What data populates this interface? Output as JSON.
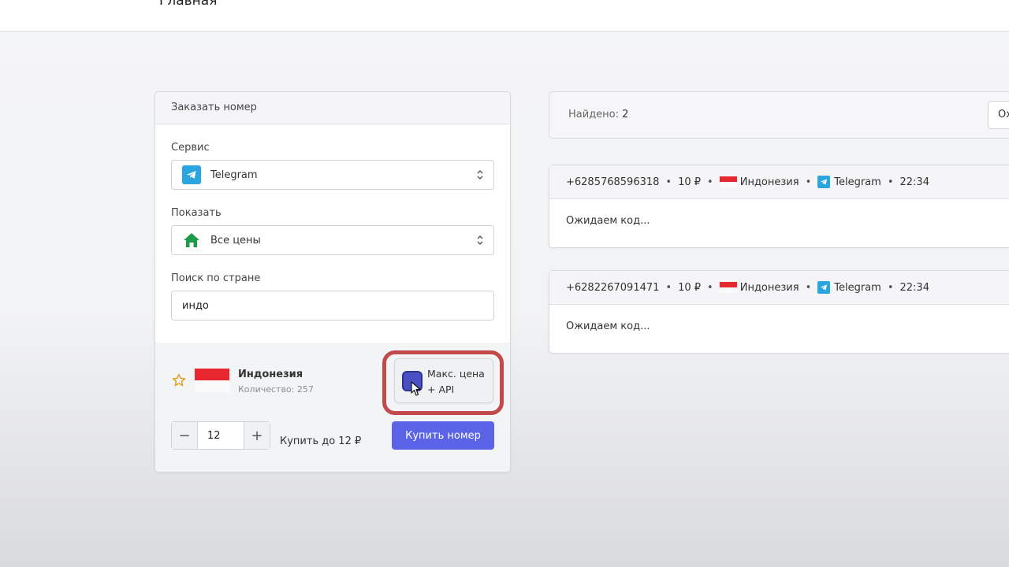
{
  "header": {
    "title": "Главная"
  },
  "order_form": {
    "title": "Заказать номер",
    "service": {
      "label": "Сервис",
      "value": "Telegram",
      "icon": "telegram-icon"
    },
    "show": {
      "label": "Показать",
      "value": "Все цены",
      "icon": "home-icon"
    },
    "country_search": {
      "label": "Поиск по стране",
      "value": "индо"
    },
    "country": {
      "name": "Индонезия",
      "quantity": "Количество: 257",
      "favorite_icon": "star-icon"
    },
    "api_button": {
      "line1": "Макс. цена",
      "line2": "+ API"
    },
    "quantity": {
      "value": "12",
      "minus": "−",
      "plus": "+"
    },
    "buy_upto": "Купить до 12 ₽",
    "buy_button": "Купить номер",
    "colors": {
      "accent": "#5b63e6",
      "highlight": "#c34a4a",
      "telegram": "#2aa5df"
    }
  },
  "results": {
    "found_label": "Найдено:",
    "found_count": "2",
    "clear_button": "Ох"
  },
  "orders": [
    {
      "phone": "+6285768596318",
      "price": "10 ₽",
      "country": "Индонезия",
      "service": "Telegram",
      "time": "22:34",
      "status": "Ожидаем код..."
    },
    {
      "phone": "+6282267091471",
      "price": "10 ₽",
      "country": "Индонезия",
      "service": "Telegram",
      "time": "22:34",
      "status": "Ожидаем код..."
    }
  ]
}
